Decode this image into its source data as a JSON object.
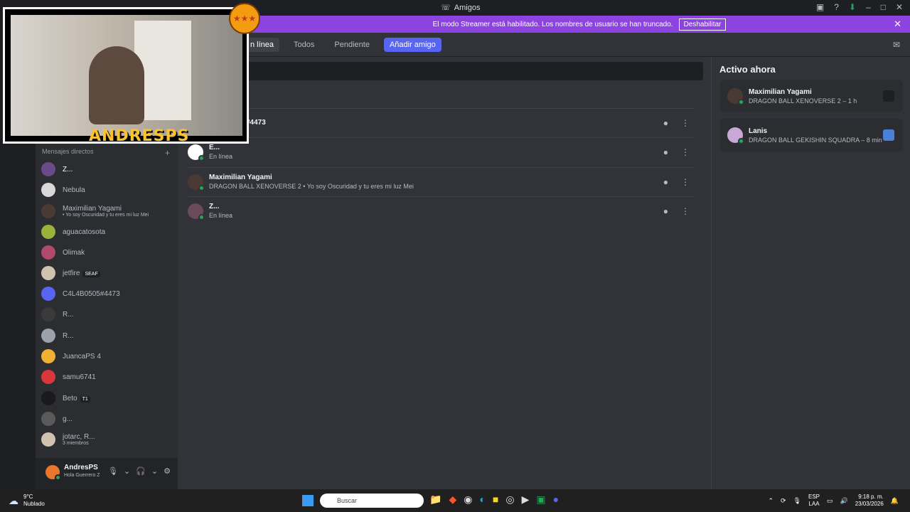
{
  "window": {
    "title": "Amigos"
  },
  "banner": {
    "text": "El modo Streamer está habilitado. Los nombres de usuario se han truncado.",
    "button": "Deshabilitar"
  },
  "tabs": [
    {
      "label": "n línea",
      "state": "active"
    },
    {
      "label": "Todos",
      "state": "normal"
    },
    {
      "label": "Pendiente",
      "state": "normal"
    },
    {
      "label": "Añadir amigo",
      "state": "primary"
    }
  ],
  "friends": [
    {
      "name": "#4473",
      "status": ""
    },
    {
      "name": "E...",
      "status": "En línea"
    },
    {
      "name": "Maximilian Yagami",
      "status": "DRAGON BALL XENOVERSE 2 • Yo soy Oscuridad y tu eres mi luz Mei"
    },
    {
      "name": "Z...",
      "status": "En línea"
    }
  ],
  "active_now": {
    "title": "Activo ahora",
    "cards": [
      {
        "name": "Maximilian Yagami",
        "activity": "DRAGON BALL XENOVERSE 2 – 1 h"
      },
      {
        "name": "Lanis",
        "activity": "DRAGON BALL GEKISHIN SQUADRA – 8 min"
      }
    ]
  },
  "dms": {
    "header": "Mensajes directos",
    "items": [
      {
        "label": "Z...",
        "sub": "",
        "badge": ""
      },
      {
        "label": "Nebula",
        "sub": "",
        "badge": ""
      },
      {
        "label": "Maximilian Yagami",
        "sub": "• Yo soy Oscuridad y tu eres mi luz Mei",
        "badge": ""
      },
      {
        "label": "aguacatosota",
        "sub": "",
        "badge": ""
      },
      {
        "label": "Olimak",
        "sub": "",
        "badge": ""
      },
      {
        "label": "jetfire",
        "sub": "",
        "badge": "SEAF"
      },
      {
        "label": "C4L4B0505#4473",
        "sub": "",
        "badge": ""
      },
      {
        "label": "R...",
        "sub": "",
        "badge": ""
      },
      {
        "label": "R...",
        "sub": "",
        "badge": ""
      },
      {
        "label": "JuancaPS 4",
        "sub": "",
        "badge": ""
      },
      {
        "label": "samu6741",
        "sub": "",
        "badge": ""
      },
      {
        "label": "Beto",
        "sub": "",
        "badge": "T1"
      },
      {
        "label": "g...",
        "sub": "",
        "badge": ""
      },
      {
        "label": "jotarc, R...",
        "sub": "3 miembros",
        "badge": ""
      }
    ]
  },
  "user": {
    "name": "AndresPS",
    "status": "Hola Guerrero Z"
  },
  "webcam": {
    "logo": "ANDRESPS"
  },
  "taskbar": {
    "temp": "9°C",
    "weather": "Nublado",
    "search": "Buscar",
    "lang1": "ESP",
    "lang2": "LAA",
    "time": "9:18 p. m.",
    "date": "23/03/2026"
  },
  "colors": {
    "accent": "#5865f2",
    "banner": "#8c43e0",
    "online": "#23a55a"
  }
}
